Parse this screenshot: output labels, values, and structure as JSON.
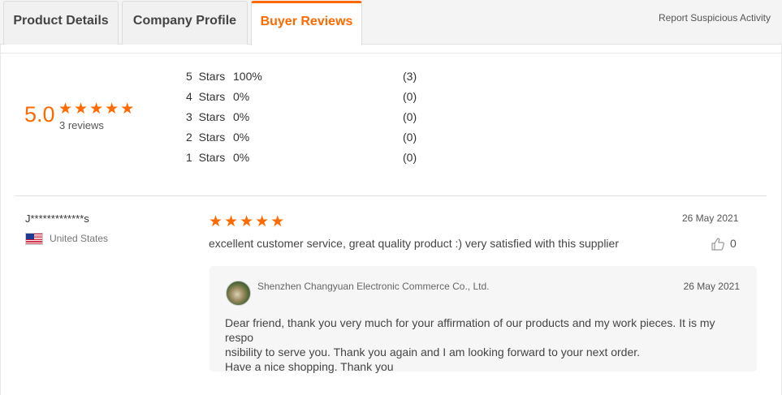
{
  "tabs": [
    {
      "label": "Product Details"
    },
    {
      "label": "Company Profile"
    },
    {
      "label": "Buyer Reviews",
      "active": true
    }
  ],
  "report_link": "Report Suspicious Activity",
  "summary": {
    "score": "5.0",
    "stars": 5,
    "review_count": "3 reviews",
    "distribution": [
      {
        "label": "5  Stars",
        "percent": "100%",
        "count": "(3)"
      },
      {
        "label": "4  Stars",
        "percent": "0%",
        "count": "(0)"
      },
      {
        "label": "3  Stars",
        "percent": "0%",
        "count": "(0)"
      },
      {
        "label": "2  Stars",
        "percent": "0%",
        "count": "(0)"
      },
      {
        "label": "1  Stars",
        "percent": "0%",
        "count": "(0)"
      }
    ]
  },
  "review": {
    "reviewer": "J*************s",
    "country": "United States",
    "stars": 5,
    "date": "26 May 2021",
    "text": "excellent customer service, great quality product :) very satisfied with this supplier",
    "likes": "0",
    "reply": {
      "company": "Shenzhen Changyuan Electronic Commerce Co., Ltd.",
      "date": "26 May 2021",
      "lines": [
        "Dear friend, thank you very much for your affirmation of our products and my work pieces. It is my respo",
        "nsibility to serve you. Thank you again and I am looking forward to your next order.",
        "Have a nice shopping. Thank you"
      ]
    }
  },
  "colors": {
    "accent": "#ff6a00"
  },
  "icons": {
    "star": "star-icon",
    "like": "thumbs-up-icon",
    "flag": "us-flag-icon"
  }
}
